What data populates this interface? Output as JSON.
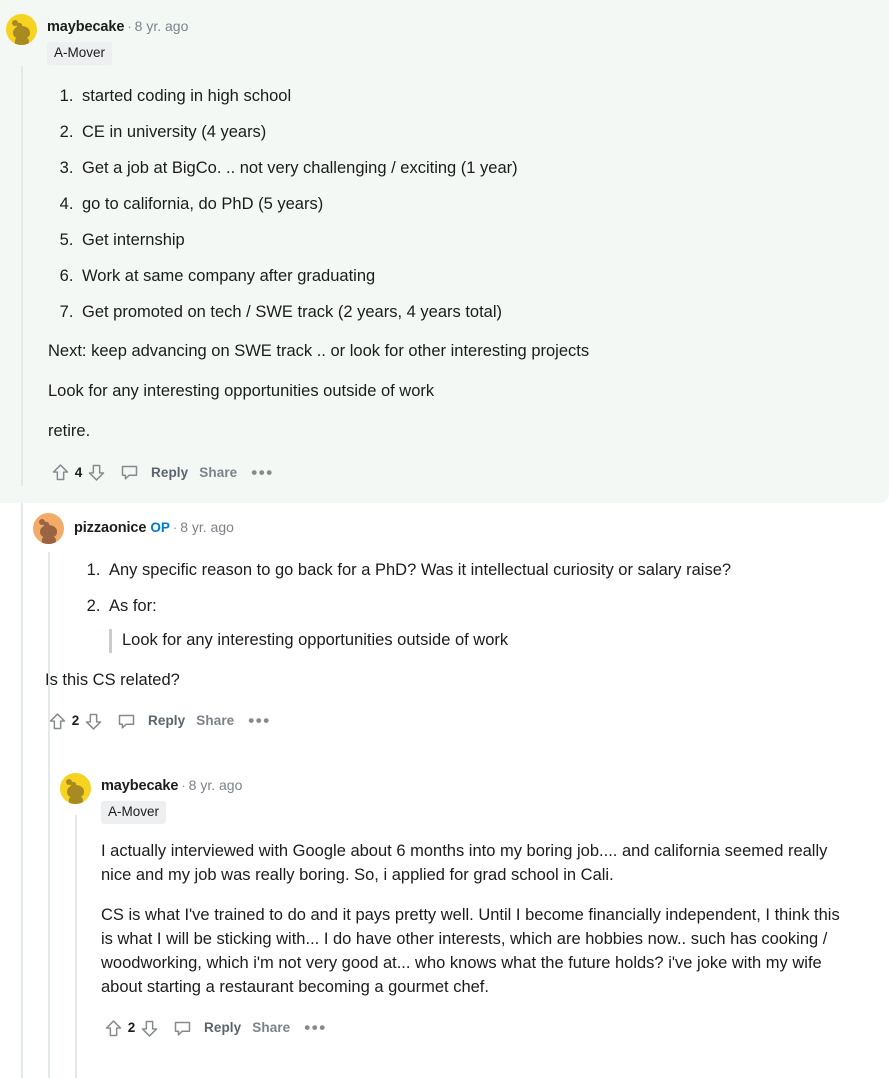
{
  "thread": {
    "comments": [
      {
        "id": "comment-1",
        "highlighted": true,
        "author": "maybecake",
        "op_label": "",
        "separator": "·",
        "timestamp": "8 yr. ago",
        "flair": "A-Mover",
        "avatar": "snoo-avatar-yellow",
        "list_items": [
          "started coding in high school",
          "CE in university (4 years)",
          "Get a job at BigCo. .. not very challenging / exciting (1 year)",
          "go to california, do PhD (5 years)",
          "Get internship",
          "Work at same company after graduating",
          "Get promoted on tech / SWE track (2 years, 4 years total)"
        ],
        "paragraphs": [
          "Next: keep advancing on SWE track .. or look for other interesting projects",
          "Look for any interesting opportunities outside of work",
          "retire."
        ],
        "actions": {
          "upvote": "upvote-arrow-icon",
          "score": "4",
          "downvote": "downvote-arrow-icon",
          "comment_icon": "comment-bubble-icon",
          "reply_label": "Reply",
          "share_label": "Share",
          "more_label": "•••"
        }
      },
      {
        "id": "comment-2",
        "highlighted": false,
        "author": "pizzaonice",
        "op_label": "OP",
        "separator": "·",
        "timestamp": "8 yr. ago",
        "flair": "",
        "avatar": "snoo-avatar-orange",
        "list_items": [
          "Any specific reason to go back for a PhD? Was it intellectual curiosity or salary raise?",
          "As for:"
        ],
        "quote": "Look for any interesting opportunities outside of work",
        "paragraphs": [
          "Is this CS related?"
        ],
        "actions": {
          "upvote": "upvote-arrow-icon",
          "score": "2",
          "downvote": "downvote-arrow-icon",
          "comment_icon": "comment-bubble-icon",
          "reply_label": "Reply",
          "share_label": "Share",
          "more_label": "•••"
        }
      },
      {
        "id": "comment-3",
        "highlighted": false,
        "author": "maybecake",
        "op_label": "",
        "separator": "·",
        "timestamp": "8 yr. ago",
        "flair": "A-Mover",
        "avatar": "snoo-avatar-yellow",
        "list_items": [],
        "paragraphs": [
          "I actually interviewed with Google about 6 months into my boring job.... and california seemed really nice and my job was really boring. So, i applied for grad school in Cali.",
          "CS is what I've trained to do and it pays pretty well. Until I become financially independent, I think this is what I will be sticking with... I do have other interests, which are hobbies now.. such has cooking / woodworking, which i'm not very good at... who knows what the future holds? i've joke with my wife about starting a restaurant becoming a gourmet chef."
        ],
        "actions": {
          "upvote": "upvote-arrow-icon",
          "score": "2",
          "downvote": "downvote-arrow-icon",
          "comment_icon": "comment-bubble-icon",
          "reply_label": "Reply",
          "share_label": "Share",
          "more_label": "•••"
        }
      }
    ]
  },
  "colors": {
    "highlight_background": "#f4f8f5",
    "page_background": "#ffffff",
    "text": "#1c1c1c",
    "muted_text": "#7c828a",
    "op_blue": "#0079d3",
    "thread_line": "#e4e8e8",
    "flair_background": "#edeff1",
    "avatar_yellow": "#f7d321",
    "avatar_orange": "#f5ab68"
  }
}
